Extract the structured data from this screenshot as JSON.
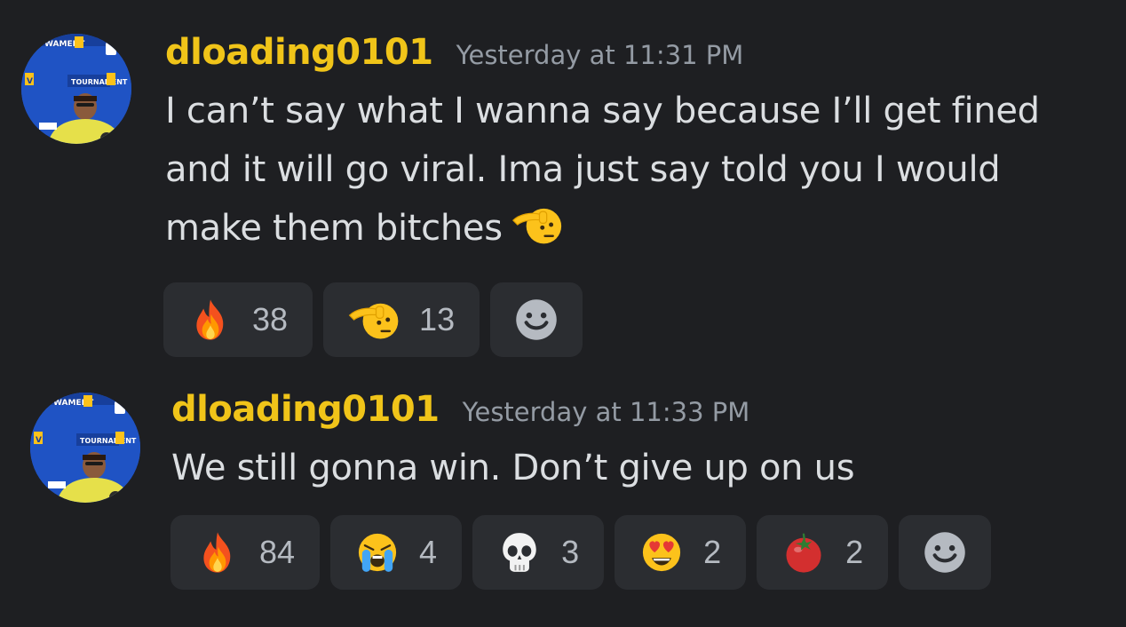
{
  "messages": [
    {
      "username": "dloading0101",
      "timestamp": "Yesterday at 11:31 PM",
      "content": "I can’t say what I wanna say because I’ll get fined and it will go viral. Ima just say told you I would make them bitches",
      "inline_emoji": "saluting-face",
      "reactions": [
        {
          "emoji": "fire",
          "count": "38"
        },
        {
          "emoji": "saluting-face",
          "count": "13"
        }
      ]
    },
    {
      "username": "dloading0101",
      "timestamp": "Yesterday at 11:33 PM",
      "content": "We still gonna win. Don’t give up on us",
      "reactions": [
        {
          "emoji": "fire",
          "count": "84"
        },
        {
          "emoji": "loudly-crying-face",
          "count": "4"
        },
        {
          "emoji": "skull",
          "count": "3"
        },
        {
          "emoji": "heart-eyes",
          "count": "2"
        },
        {
          "emoji": "tomato",
          "count": "2"
        }
      ]
    }
  ],
  "colors": {
    "background": "#1e1f22",
    "username": "#f0c419",
    "timestamp": "#949ba4",
    "text": "#dbdee1",
    "reaction_bg": "#2b2d31"
  }
}
